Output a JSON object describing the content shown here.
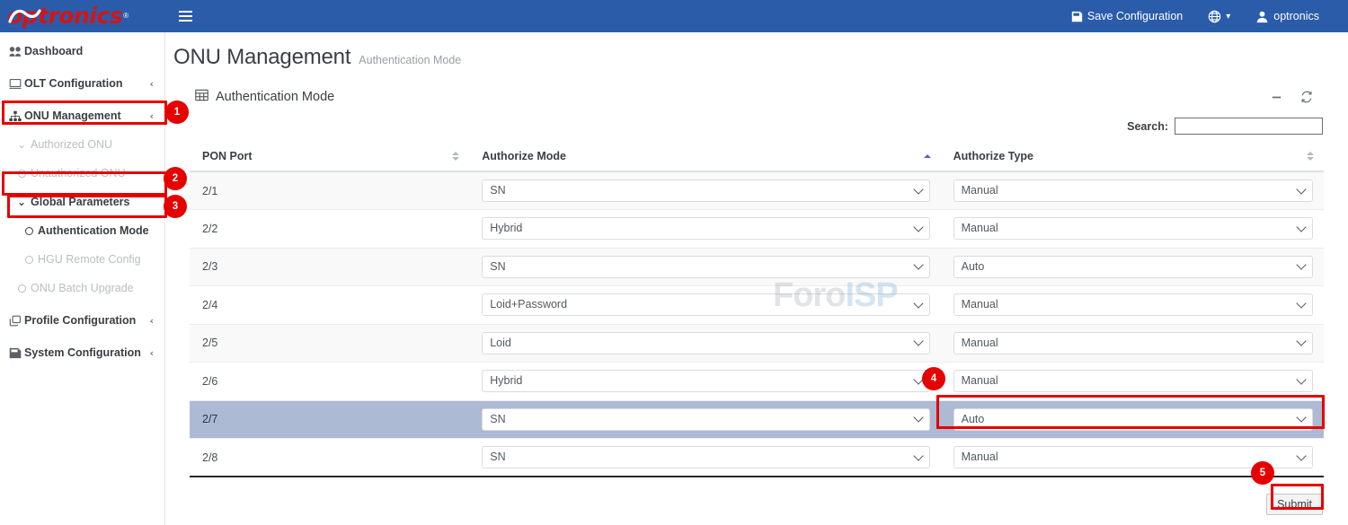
{
  "topbar": {
    "brand": "optronics",
    "brand_reg": "®",
    "menu_toggle_icon": "hamburger-icon",
    "save_config_label": "Save Configuration",
    "save_config_icon": "save-icon",
    "language_icon": "globe-icon",
    "language_caret": "▾",
    "user_icon": "user-icon",
    "user_name": "optronics",
    "bg_color": "#2a5caa"
  },
  "sidebar": {
    "items": [
      {
        "label": "Dashboard",
        "icon": "dashboard-icon",
        "chevron": "",
        "level": 0,
        "state": "normal"
      },
      {
        "label": "OLT Configuration",
        "icon": "monitor-icon",
        "chevron": "‹",
        "level": 0,
        "state": "normal"
      },
      {
        "label": "ONU Management",
        "icon": "sitemap-icon",
        "chevron": "‹",
        "level": 0,
        "state": "highlighted"
      },
      {
        "label": "Authorized ONU",
        "icon": "chevron-down-icon",
        "chevron": "",
        "level": 1,
        "state": "dim"
      },
      {
        "label": "Unauthorized ONU",
        "icon": "circle-icon",
        "chevron": "",
        "level": 1,
        "state": "dim"
      },
      {
        "label": "Global Parameters",
        "icon": "chevron-down-icon",
        "chevron": "",
        "level": 1,
        "state": "highlighted"
      },
      {
        "label": "Authentication Mode",
        "icon": "circle-icon",
        "chevron": "",
        "level": 2,
        "state": "active"
      },
      {
        "label": "HGU Remote Config",
        "icon": "circle-icon",
        "chevron": "",
        "level": 2,
        "state": "dim"
      },
      {
        "label": "ONU Batch Upgrade",
        "icon": "circle-icon",
        "chevron": "",
        "level": 1,
        "state": "dim"
      },
      {
        "label": "Profile Configuration",
        "icon": "layers-icon",
        "chevron": "‹",
        "level": 0,
        "state": "normal"
      },
      {
        "label": "System Configuration",
        "icon": "save-icon",
        "chevron": "‹",
        "level": 0,
        "state": "normal"
      }
    ]
  },
  "page": {
    "title": "ONU Management",
    "subtitle": "Authentication Mode"
  },
  "card": {
    "title": "Authentication Mode",
    "title_icon": "table-icon",
    "minimize_icon": "minimize-icon",
    "refresh_icon": "refresh-icon"
  },
  "search": {
    "label": "Search:",
    "value": "",
    "placeholder": ""
  },
  "table": {
    "columns": [
      {
        "label": "PON Port",
        "sort": "none"
      },
      {
        "label": "Authorize Mode",
        "sort": "asc"
      },
      {
        "label": "Authorize Type",
        "sort": "none"
      }
    ],
    "authorize_mode_options": [
      "SN",
      "Loid",
      "Loid+Password",
      "Hybrid"
    ],
    "authorize_type_options": [
      "Manual",
      "Auto"
    ],
    "rows": [
      {
        "port": "2/1",
        "mode": "SN",
        "type": "Manual",
        "selected": false
      },
      {
        "port": "2/2",
        "mode": "Hybrid",
        "type": "Manual",
        "selected": false
      },
      {
        "port": "2/3",
        "mode": "SN",
        "type": "Auto",
        "selected": false
      },
      {
        "port": "2/4",
        "mode": "Loid+Password",
        "type": "Manual",
        "selected": false
      },
      {
        "port": "2/5",
        "mode": "Loid",
        "type": "Manual",
        "selected": false
      },
      {
        "port": "2/6",
        "mode": "Hybrid",
        "type": "Manual",
        "selected": false
      },
      {
        "port": "2/7",
        "mode": "SN",
        "type": "Auto",
        "selected": true
      },
      {
        "port": "2/8",
        "mode": "SN",
        "type": "Manual",
        "selected": false
      }
    ]
  },
  "submit": {
    "label": "Submit"
  },
  "watermark": {
    "part1": "Foro",
    "part2": "ISP"
  },
  "annotations": {
    "color": "#e60000",
    "markers": [
      {
        "n": "1",
        "target": "ONU Management sidebar item"
      },
      {
        "n": "2",
        "target": "Global Parameters sidebar item"
      },
      {
        "n": "3",
        "target": "Authentication Mode sidebar item"
      },
      {
        "n": "4",
        "target": "Authorize Type select for PON port 2/7"
      },
      {
        "n": "5",
        "target": "Submit button"
      }
    ]
  }
}
